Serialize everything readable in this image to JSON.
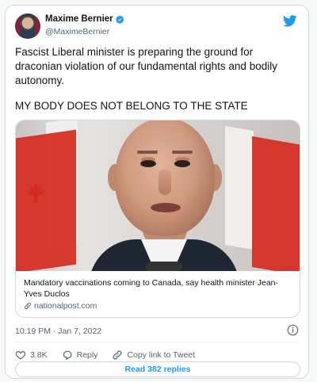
{
  "author": {
    "display_name": "Maxime Bernier",
    "handle": "@MaximeBernier",
    "verified": true
  },
  "tweet": {
    "paragraphs": [
      "Fascist Liberal minister is preparing the ground for draconian violation of our fundamental rights and bodily autonomy.",
      "MY BODY DOES NOT BELONG TO THE STATE"
    ]
  },
  "link_card": {
    "title": "Mandatory vaccinations coming to Canada, say health minister Jean-Yves Duclos",
    "domain": "nationalpost.com"
  },
  "meta": {
    "timestamp": "10:19 PM · Jan 7, 2022"
  },
  "actions": {
    "like_count": "3.8K",
    "reply_label": "Reply",
    "copy_link_label": "Copy link to Tweet"
  },
  "read_replies_label": "Read 382 replies",
  "colors": {
    "accent": "#1d9bf0",
    "like": "#f91880",
    "border": "#cfd9de",
    "secondary_text": "#536471"
  },
  "icons": [
    "verified-badge-icon",
    "twitter-bird-icon",
    "link-icon",
    "info-icon",
    "heart-icon",
    "reply-icon",
    "copy-link-icon"
  ]
}
